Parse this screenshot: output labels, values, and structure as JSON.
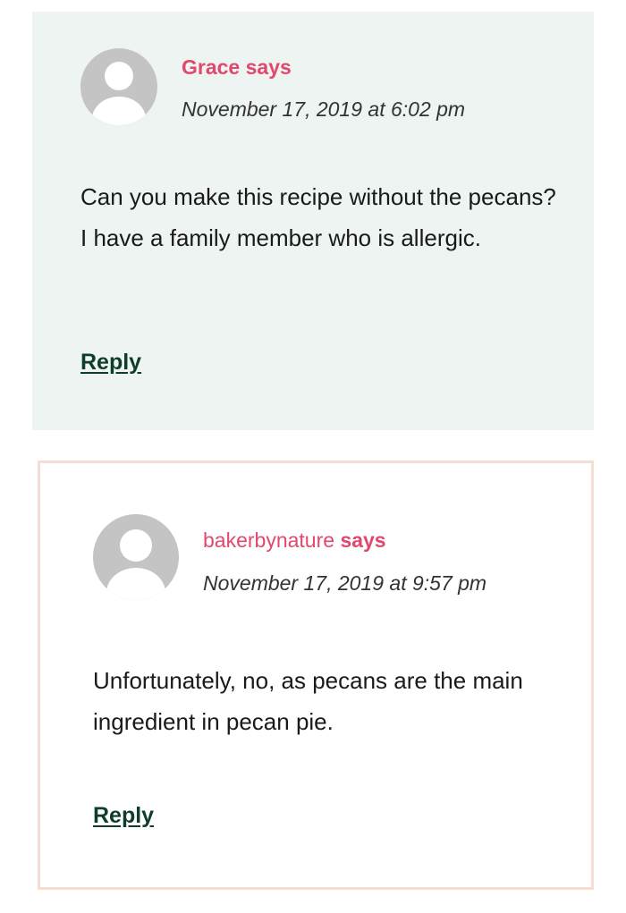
{
  "comments": [
    {
      "author": "Grace",
      "says": "says",
      "date": "November 17, 2019 at 6:02 pm",
      "text": "Can you make this recipe without the pecans? I have a family member who is allergic.",
      "reply_label": "Reply",
      "background": "#eef4f1"
    },
    {
      "author": "bakerbynature",
      "says": "says",
      "date": "November 17, 2019 at 9:57 pm",
      "text": "Unfortunately, no, as pecans are the main ingredient in pecan pie.",
      "reply_label": "Reply",
      "border_color": "#f5ddd2"
    }
  ],
  "colors": {
    "author": "#e1486d",
    "reply": "#0f3d2a",
    "avatar": "#c4c4c4"
  },
  "icons": {
    "avatar": "user-avatar-icon"
  }
}
